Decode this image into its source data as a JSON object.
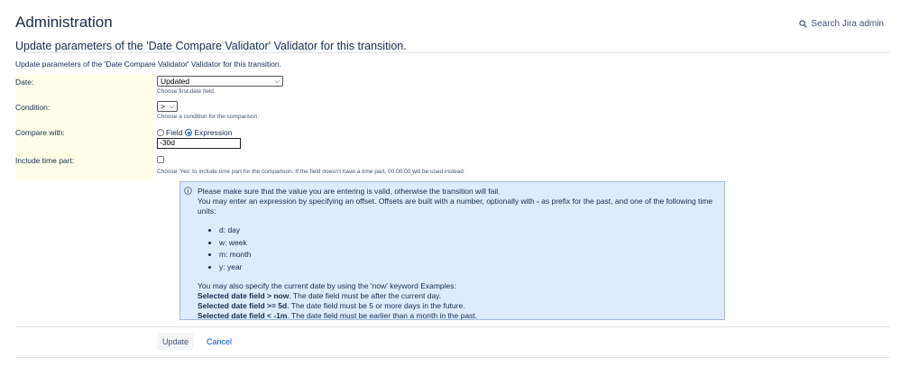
{
  "header": {
    "title": "Administration",
    "search_label": "Search Jira admin"
  },
  "page": {
    "heading": "Update parameters of the 'Date Compare Validator' Validator for this transition.",
    "description": "Update parameters of the 'Date Compare Validator' Validator for this transition."
  },
  "form": {
    "date": {
      "label": "Date:",
      "value": "Updated",
      "help": "Choose first date field."
    },
    "condition": {
      "label": "Condition:",
      "value": ">",
      "help": "Choose a condition for the comparison."
    },
    "compare": {
      "label": "Compare with:",
      "option_field": "Field",
      "option_expression": "Expression",
      "selected": "Expression",
      "expression_value": "-30d"
    },
    "include_time": {
      "label": "Include time part:",
      "checked": false,
      "help": "Choose 'Yes' to include time part for the comparison. If the field doesn't have a time part, 00:00:00 will be used instead."
    }
  },
  "info": {
    "line1": "Please make sure that the value you are entering is valid, otherwise the transition will fail.",
    "line2_pre": "You may enter an expression by specifying an offset. Offsets are built with a number, optionally with ",
    "line2_bold": "-",
    "line2_post": " as prefix for the past, and one of the following time units:",
    "units": [
      "d: day",
      "w: week",
      "m: month",
      "y: year"
    ],
    "now_intro": "You may also specify the current date by using the 'now' keyword Examples:",
    "examples": [
      {
        "bold": "Selected date field > now",
        "text": ". The date field must be after the current day."
      },
      {
        "bold": "Selected date field >= 5d",
        "text": ". The date field must be 5 or more days in the future."
      },
      {
        "bold": "Selected date field < -1m",
        "text": ". The date field must be earlier than a month in the past."
      }
    ]
  },
  "actions": {
    "update_label": "Update",
    "cancel_label": "Cancel"
  },
  "colors": {
    "info_bg": "#deebff",
    "label_bg": "#ffffe9",
    "link": "#0052cc"
  }
}
